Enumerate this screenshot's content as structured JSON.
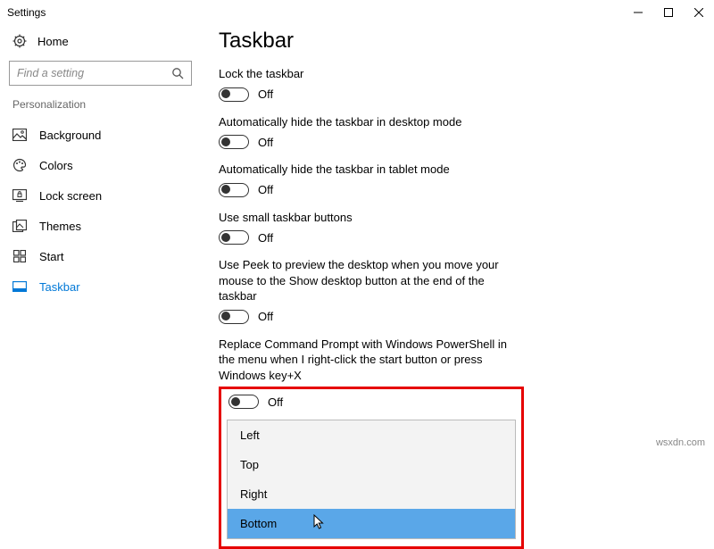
{
  "window": {
    "title": "Settings"
  },
  "sidebar": {
    "home_label": "Home",
    "search_placeholder": "Find a setting",
    "category_label": "Personalization",
    "items": [
      {
        "label": "Background"
      },
      {
        "label": "Colors"
      },
      {
        "label": "Lock screen"
      },
      {
        "label": "Themes"
      },
      {
        "label": "Start"
      },
      {
        "label": "Taskbar"
      }
    ]
  },
  "main": {
    "heading": "Taskbar",
    "settings": [
      {
        "label": "Lock the taskbar",
        "state": "Off"
      },
      {
        "label": "Automatically hide the taskbar in desktop mode",
        "state": "Off"
      },
      {
        "label": "Automatically hide the taskbar in tablet mode",
        "state": "Off"
      },
      {
        "label": "Use small taskbar buttons",
        "state": "Off"
      },
      {
        "label": "Use Peek to preview the desktop when you move your mouse to the Show desktop button at the end of the taskbar",
        "state": "Off"
      },
      {
        "label": "Replace Command Prompt with Windows PowerShell in the menu when I right-click the start button or press Windows key+X",
        "state": "Off"
      }
    ],
    "dropdown": {
      "options": [
        "Left",
        "Top",
        "Right",
        "Bottom"
      ],
      "selected": "Bottom"
    }
  },
  "watermark": "wsxdn.com"
}
